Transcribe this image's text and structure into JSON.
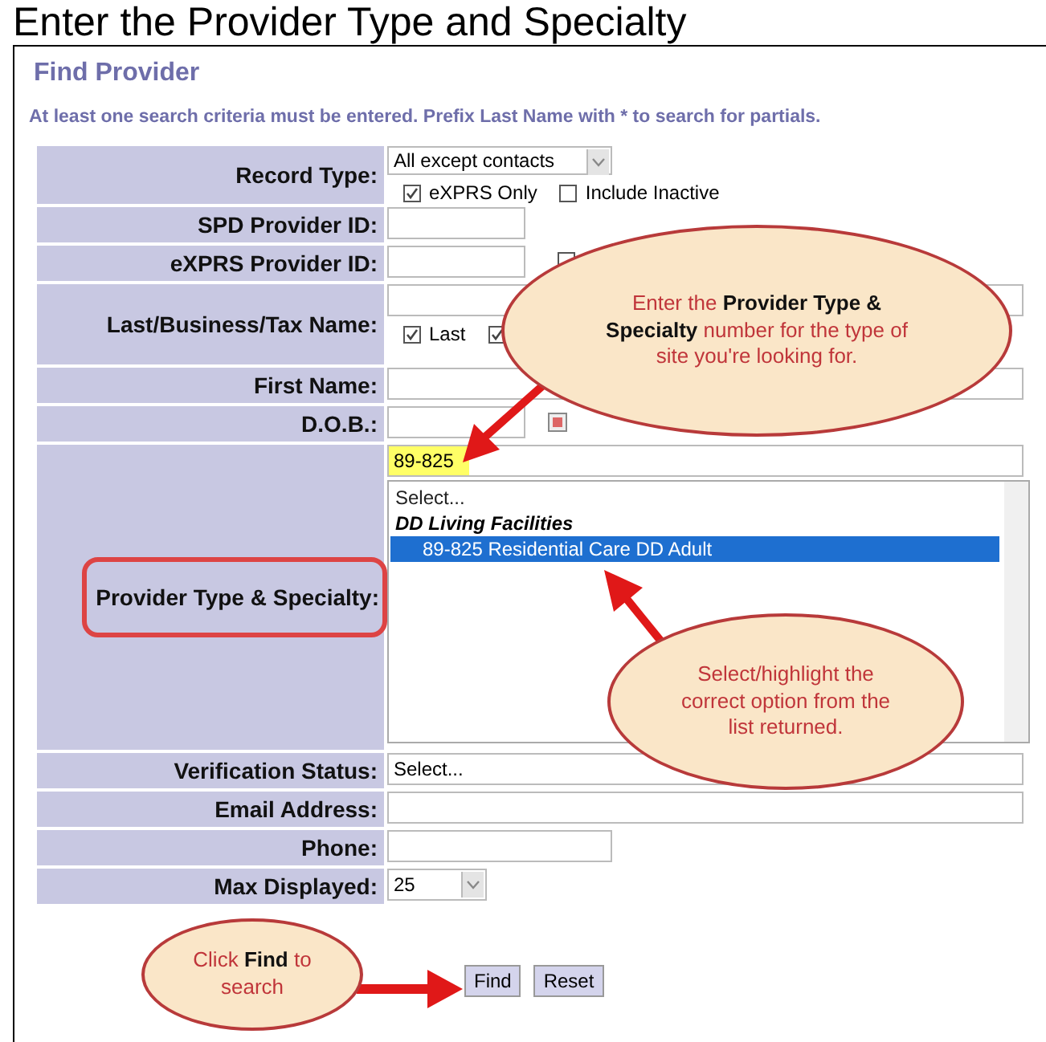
{
  "heading": "Enter the Provider Type and Specialty",
  "title": "Find Provider",
  "notice": "At least one search criteria must be entered. Prefix Last Name with * to search for partials.",
  "fields": [
    {
      "label": "Record Type:",
      "kind": "select",
      "value": "All except contacts",
      "circled": false,
      "checkboxes": [
        {
          "label": "eXPRS Only",
          "checked": true
        },
        {
          "label": "Include Inactive",
          "checked": false
        }
      ]
    },
    {
      "label": "SPD Provider ID:",
      "kind": "text",
      "circled": false
    },
    {
      "label": "eXPRS Provider ID:",
      "kind": "text",
      "circled": false,
      "checkboxes": [
        {
          "checked": false
        }
      ]
    },
    {
      "label": "Last/Business/Tax Name:",
      "kind": "text",
      "circled": false,
      "checkboxes": [
        {
          "label": "Last",
          "checked": true
        },
        {
          "checked": true
        }
      ]
    },
    {
      "label": "First Name:",
      "kind": "text",
      "circled": false
    },
    {
      "label": "D.O.B.:",
      "kind": "date",
      "circled": false
    },
    {
      "label": "Provider Type & Specialty:",
      "kind": "listbox",
      "circled": true,
      "filter": {
        "value": "89-825",
        "highlighted": true
      },
      "options": [
        {
          "label": "Select...",
          "kind": "option",
          "selected": false
        },
        {
          "label": "DD Living Facilities",
          "kind": "group"
        },
        {
          "label": "89-825 Residential Care DD Adult",
          "kind": "option",
          "selected": true
        }
      ]
    },
    {
      "label": "Verification Status:",
      "kind": "plain-select",
      "value": "Select...",
      "circled": false
    },
    {
      "label": "Email Address:",
      "kind": "text",
      "circled": false
    },
    {
      "label": "Phone:",
      "kind": "text",
      "circled": false
    },
    {
      "label": "Max Displayed:",
      "kind": "select",
      "value": "25",
      "circled": false
    }
  ],
  "buttons": [
    "Find",
    "Reset"
  ],
  "callouts": [
    {
      "text": "Enter the **Provider Type & Specialty** number for the type of site you're looking for."
    },
    {
      "text": "Select/highlight the correct option from the list returned."
    },
    {
      "text": "Click **Find** to search"
    }
  ]
}
